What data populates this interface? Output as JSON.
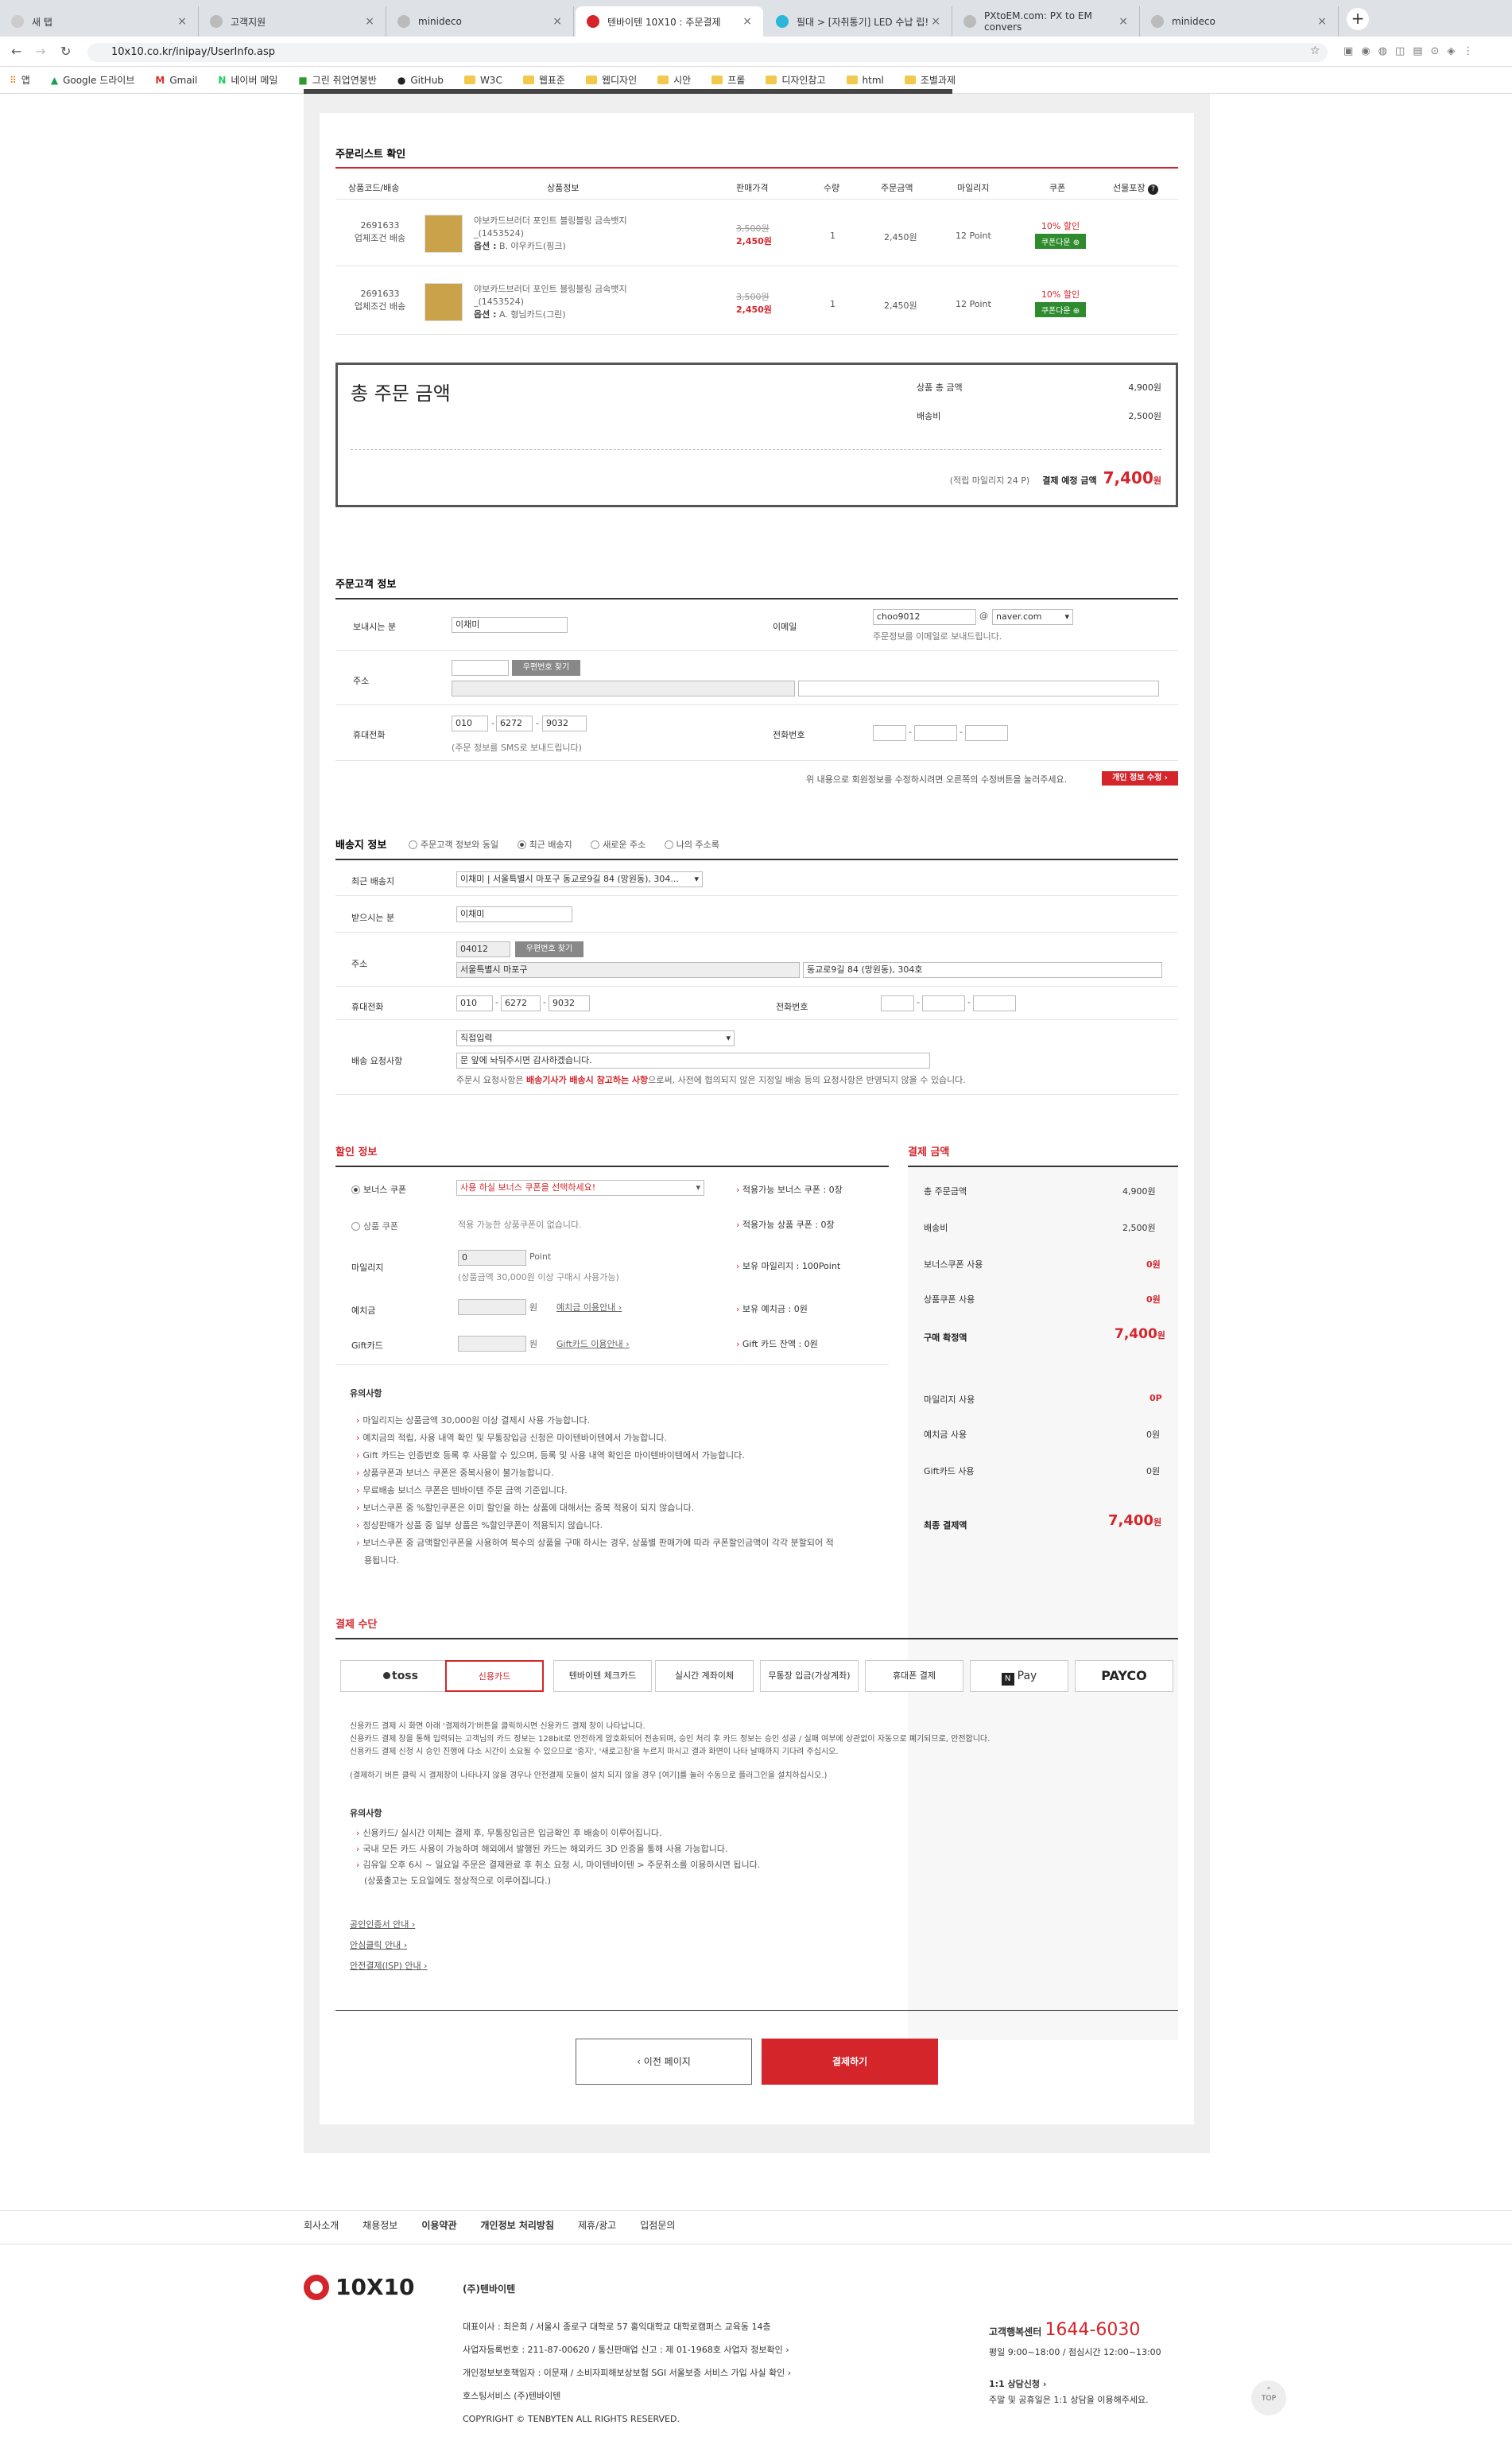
{
  "browser": {
    "tabs": [
      "새 탭",
      "고객지원",
      "minideco",
      "텐바이텐 10X10 : 주문결제",
      "필대 > [자취통기] LED 수납 립!",
      "PXtoEM.com: PX to EM convers",
      "minideco"
    ],
    "url": "10x10.co.kr/inipay/UserInfo.asp",
    "bookmarks": [
      "앱",
      "Google 드라이브",
      "Gmail",
      "네이버 메일",
      "그린 취업연봉반",
      "GitHub",
      "W3C",
      "웹표준",
      "웹디자인",
      "시안",
      "프롤",
      "디자인참고",
      "html",
      "조별과제"
    ]
  },
  "orderlist": {
    "title": "주문리스트 확인",
    "headers": [
      "상품코드/배송",
      "상품정보",
      "판매가격",
      "수량",
      "주문금액",
      "마일리지",
      "쿠폰",
      "선물포장"
    ],
    "rows": [
      {
        "code": "2691633",
        "ship": "업체조건 배송",
        "name": "야보카드브러더 포인트 블링블링 금속뱃지",
        "sku": "_(1453524)",
        "opt_label": "옵션 :",
        "opt": "B. 야우카드(핑크)",
        "orig": "3,500원",
        "price": "2,450원",
        "qty": "1",
        "total": "2,450원",
        "mile": "12 Point",
        "coupon": "10% 할인",
        "coupon_btn": "쿠폰다운 ⊕"
      },
      {
        "code": "2691633",
        "ship": "업체조건 배송",
        "name": "야보카드브러더 포인트 블링블링 금속뱃지",
        "sku": "_(1453524)",
        "opt_label": "옵션 :",
        "opt": "A. 형님카드(그린)",
        "orig": "3,500원",
        "price": "2,450원",
        "qty": "1",
        "total": "2,450원",
        "mile": "12 Point",
        "coupon": "10% 할인",
        "coupon_btn": "쿠폰다운 ⊕"
      }
    ]
  },
  "summary": {
    "title": "총 주문 금액",
    "goods_label": "상품 총 금액",
    "goods": "4,900원",
    "ship_label": "배송비",
    "ship": "2,500원",
    "mile_note": "(적립 마일리지 24 P)",
    "pay_label": "결제 예정 금액",
    "pay": "7,400",
    "won": "원"
  },
  "customer": {
    "title": "주문고객 정보",
    "sender_label": "보내시는 분",
    "sender": "이채미",
    "email_label": "이메일",
    "email_id": "choo9012",
    "email_at": "@",
    "email_domain": "naver.com",
    "email_note": "주문정보를 이메일로 보내드립니다.",
    "addr_label": "주소",
    "zip_btn": "우편번호 찾기",
    "phone_label": "휴대전화",
    "p1": "010",
    "p2": "6272",
    "p3": "9032",
    "phone_note": "(주문 정보를 SMS로 보내드립니다)",
    "tel_label": "전화번호",
    "dash": "-",
    "edit_note": "위 내용으로 회원정보를 수정하시려면 오른쪽의 수정버튼을 눌러주세요.",
    "edit_btn": "개인 정보 수정 ›"
  },
  "delivery": {
    "title": "배송지 정보",
    "opts": [
      "주문고객 정보와 동일",
      "최근 배송지",
      "새로운 주소",
      "나의 주소록"
    ],
    "recent_label": "최근 배송지",
    "recent": "이채미 | 서울특별시 마포구 동교로9길 84 (망원동), 304...",
    "recv_label": "받으시는 분",
    "recv": "이채미",
    "addr_label": "주소",
    "zip": "04012",
    "zip_btn": "우편번호 찾기",
    "addr1": "서울특별시 마포구",
    "addr2": "동교로9길 84  (망원동), 304호",
    "phone_label": "휴대전화",
    "p1": "010",
    "p2": "6272",
    "p3": "9032",
    "tel_label": "전화번호",
    "req_label": "배송 요청사항",
    "req_select": "직접입력",
    "req_text": "문 앞에 놔둬주시면 감사하겠습니다.",
    "req_note_a": "주문시 요청사항은",
    "req_note_b": "배송기사가 배송시 참고하는 사항",
    "req_note_c": "으로써, 사전에 협의되지 않은 지정일 배송 등의 요청사항은 반영되지 않을 수 있습니다."
  },
  "discount": {
    "title": "할인 정보",
    "bonus_label": "보너스 쿠폰",
    "bonus_select": "사용 하실 보너스 쿠폰을 선택하세요!",
    "bonus_avail": "적용가능 보너스 쿠폰 : 0장",
    "item_label": "상품 쿠폰",
    "item_text": "적용 가능한 상품쿠폰이 없습니다.",
    "item_avail": "적용가능 상품 쿠폰 : 0장",
    "mile_label": "마일리지",
    "mile_val": "0",
    "mile_unit": "Point",
    "mile_note": "(상품금액 30,000원 이상 구매시 사용가능)",
    "mile_have": "보유 마일리지 : 100Point",
    "dep_label": "예치금",
    "dep_unit": "원",
    "dep_link": "예치금 이용안내 ›",
    "dep_have": "보유 예치금 : 0원",
    "gift_label": "Gift카드",
    "gift_unit": "원",
    "gift_link": "Gift카드 이용안내 ›",
    "gift_have": "Gift 카드 잔액 : 0원",
    "notes_title": "유의사항",
    "notes": [
      "마일리지는 상품금액 30,000원 이상 결제시 사용 가능합니다.",
      "예치금의 적립, 사용 내역 확인 및 무통장입금 신청은 마이텐바이텐에서 가능합니다.",
      "Gift 카드는 인증번호 등록 후 사용할 수 있으며, 등록 및 사용 내역 확인은 마이텐바이텐에서 가능합니다.",
      "상품쿠폰과 보너스 쿠폰은 중복사용이 불가능합니다.",
      "무료배송 보너스 쿠폰은 텐바이텐 주문 금액 기준입니다.",
      "보너스쿠폰 중 %할인쿠폰은 이미 할인을 하는 상품에 대해서는 중복 적용이 되지 않습니다.",
      "정상판매가 상품 중 일부 상품은 %할인쿠폰이 적용되지 않습니다.",
      "보너스쿠폰 중 금액할인쿠폰을 사용하여 복수의 상품을 구매 하시는 경우, 상품별 판매가에 따라 쿠폰할인금액이 각각 분할되어 적",
      "용됩니다."
    ]
  },
  "paysum": {
    "title": "결제 금액",
    "rows": [
      [
        "총 주문금액",
        "4,900원"
      ],
      [
        "배송비",
        "2,500원"
      ],
      [
        "보너스쿠폰 사용",
        "0원"
      ],
      [
        "상품쿠폰 사용",
        "0원"
      ]
    ],
    "confirm_label": "구매 확정액",
    "confirm": "7,400",
    "won": "원",
    "rows2": [
      [
        "마일리지 사용",
        "0P"
      ],
      [
        "예치금 사용",
        "0원"
      ],
      [
        "Gift카드 사용",
        "0원"
      ]
    ],
    "final_label": "최종 결제액",
    "final": "7,400"
  },
  "method": {
    "title": "결제 수단",
    "options": [
      "toss",
      "신용카드",
      "텐바이텐 체크카드",
      "실시간 계좌이체",
      "무통장 입금(가상계좌)",
      "휴대폰 결제",
      "Pay",
      "PAYCO"
    ],
    "info": [
      "신용카드 결제 시 화면 아래 '결제하기'버튼을 클릭하시면 신용카드 결제 창이 나타납니다.",
      "신용카드 결제 창을 통해 입력되는 고객님의 카드 정보는 128bit로 안전하게 암호화되어 전송되며, 승인 처리 후 카드 정보는 승인 성공 / 실패 여부에 상관없이 자동으로 폐기되므로, 안전합니다.",
      "신용카드 결제 신청 시 승인 진행에 다소 시간이 소요될 수 있으므로 '중지', '새로고침'을 누르지 마시고 결과 화면이 나타 날때까지 기다려 주십시오.",
      "(결제하기 버튼 클릭 시 결제창이 나타나지 않을 경우나 안전결제 모듈이 설치 되지 않을 경우 [여기]를 눌러 수동으로 플러그인을 설치하십시오.)"
    ],
    "notes_title": "유의사항",
    "notes": [
      "신용카드/ 실시간 이체는 결제 후, 무통장입금은 입금확인 후 배송이 이루어집니다.",
      "국내 모든 카드 사용이 가능하며 해외에서 발행된 카드는 해외카드 3D 인증을 통해 사용 가능합니다.",
      "김유일 오후 6시 ~ 일요일 주문은 결제완료 후 취소 요청 시, 마이텐바이텐 > 주문취소를 이용하시면 됩니다.",
      "(상품출고는 도요일에도 정상적으로 이루어집니다.)"
    ],
    "links": [
      "공인인증서 안내 ›",
      "안심클릭 안내 ›",
      "안전결제(ISP) 안내 ›"
    ]
  },
  "buttons": {
    "prev": "‹ 이전 페이지",
    "pay": "결제하기"
  },
  "footer": {
    "nav": [
      "회사소개",
      "채용정보",
      "이용약관",
      "개인정보 처리방침",
      "제휴/광고",
      "입점문의"
    ],
    "logo": "10X10",
    "company": "(주)텐바이텐",
    "lines": [
      "대표이사 : 최은희 / 서울시 종로구 대학로 57 홍익대학교 대학로캠퍼스 교육동 14층",
      "사업자등록번호 : 211-87-00620 / 통신판매업 신고 : 제 01-1968호  사업자 정보확인 ›",
      "개인정보보호책임자 : 이문재 / 소비자피해보상보험 SGI 서울보증  서비스 가입 사실 확인 ›",
      "호스팅서비스 (주)텐바이텐",
      "COPYRIGHT © TENBYTEN ALL RIGHTS RESERVED."
    ],
    "cs_label": "고객행복센터",
    "cs_phone": "1644-6030",
    "cs_hours": "평일 9:00~18:00 / 점심시간 12:00~13:00",
    "cs2": "1:1 상담신청 ›",
    "cs3": "주말 및 공휴일은 1:1 상담을 이용해주세요.",
    "top": "TOP"
  },
  "colors": {
    "accent": "#d4252b",
    "coupon": "#2e8b2e"
  }
}
